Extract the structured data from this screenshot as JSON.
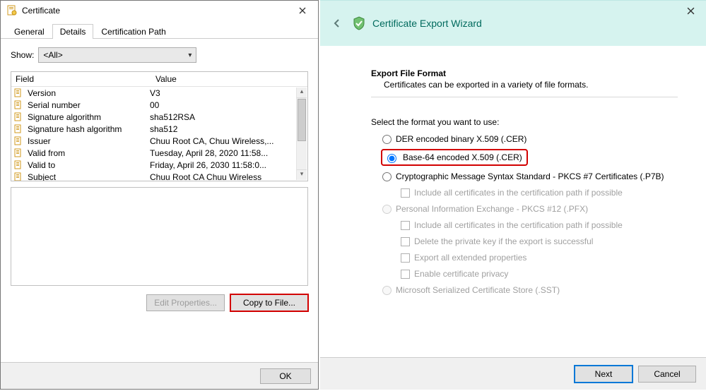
{
  "cert": {
    "title": "Certificate",
    "tabs": {
      "general": "General",
      "details": "Details",
      "path": "Certification Path"
    },
    "show_label": "Show:",
    "show_value": "<All>",
    "col_field": "Field",
    "col_value": "Value",
    "fields": [
      {
        "f": "Version",
        "v": "V3"
      },
      {
        "f": "Serial number",
        "v": "00"
      },
      {
        "f": "Signature algorithm",
        "v": "sha512RSA"
      },
      {
        "f": "Signature hash algorithm",
        "v": "sha512"
      },
      {
        "f": "Issuer",
        "v": "Chuu Root CA, Chuu Wireless,..."
      },
      {
        "f": "Valid from",
        "v": "Tuesday, April 28, 2020 11:58..."
      },
      {
        "f": "Valid to",
        "v": "Friday, April 26, 2030 11:58:0..."
      },
      {
        "f": "Subject",
        "v": "Chuu Root CA  Chuu Wireless"
      }
    ],
    "edit_btn": "Edit Properties...",
    "copy_btn": "Copy to File...",
    "ok_btn": "OK"
  },
  "wizard": {
    "title": "Certificate Export Wizard",
    "section_title": "Export File Format",
    "section_sub": "Certificates can be exported in a variety of file formats.",
    "prompt": "Select the format you want to use:",
    "opt_der": "DER encoded binary X.509 (.CER)",
    "opt_b64": "Base-64 encoded X.509 (.CER)",
    "opt_p7b": "Cryptographic Message Syntax Standard - PKCS #7 Certificates (.P7B)",
    "opt_p7b_sub": "Include all certificates in the certification path if possible",
    "opt_pfx": "Personal Information Exchange - PKCS #12 (.PFX)",
    "opt_pfx_sub1": "Include all certificates in the certification path if possible",
    "opt_pfx_sub2": "Delete the private key if the export is successful",
    "opt_pfx_sub3": "Export all extended properties",
    "opt_pfx_sub4": "Enable certificate privacy",
    "opt_sst": "Microsoft Serialized Certificate Store (.SST)",
    "next_btn": "Next",
    "cancel_btn": "Cancel"
  }
}
